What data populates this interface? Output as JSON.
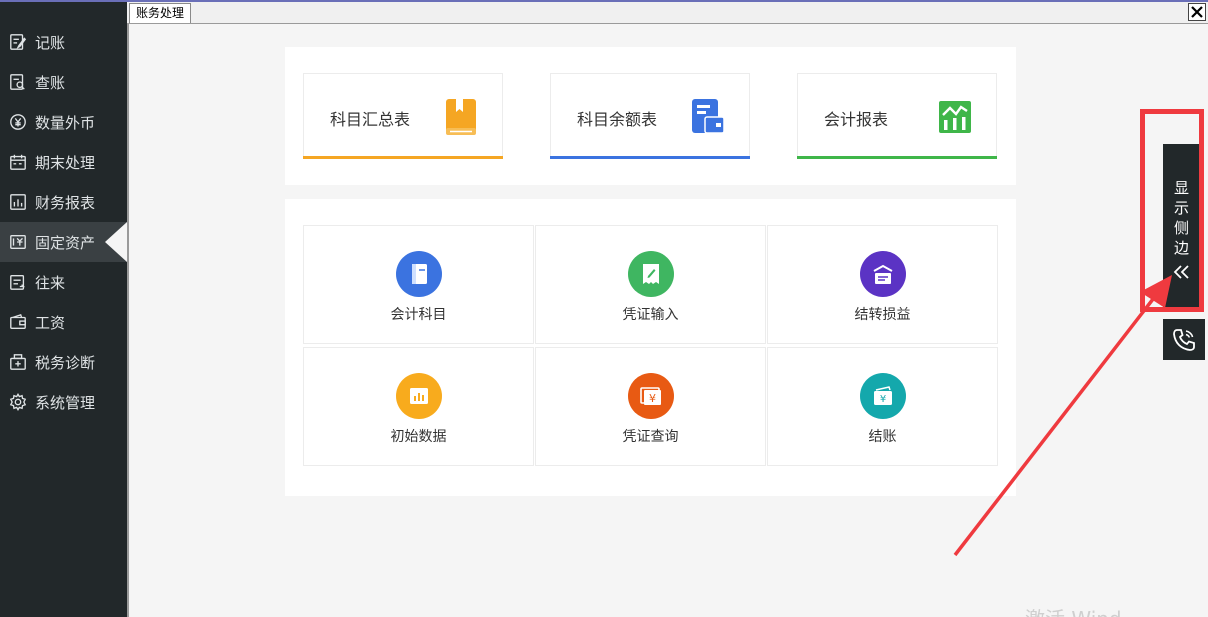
{
  "sidebar": {
    "items": [
      {
        "label": "记账",
        "icon": "edit-icon"
      },
      {
        "label": "查账",
        "icon": "search-doc-icon"
      },
      {
        "label": "数量外币",
        "icon": "yen-circle-icon"
      },
      {
        "label": "期末处理",
        "icon": "calendar-icon"
      },
      {
        "label": "财务报表",
        "icon": "chart-icon"
      },
      {
        "label": "固定资产",
        "icon": "asset-icon",
        "active": true
      },
      {
        "label": "往来",
        "icon": "exchange-icon"
      },
      {
        "label": "工资",
        "icon": "wallet-icon"
      },
      {
        "label": "税务诊断",
        "icon": "tax-icon"
      },
      {
        "label": "系统管理",
        "icon": "gear-icon"
      }
    ]
  },
  "tabbar": {
    "tab_label": "账务处理",
    "close_icon": "close-icon"
  },
  "reports": [
    {
      "label": "科目汇总表",
      "icon": "book-icon",
      "color": "#f5a623"
    },
    {
      "label": "科目余额表",
      "icon": "wallet-card-icon",
      "color": "#3b73e0"
    },
    {
      "label": "会计报表",
      "icon": "chart-bar-icon",
      "color": "#3fb649"
    }
  ],
  "functions": [
    {
      "label": "会计科目",
      "icon": "book-icon",
      "color": "#3b73e0"
    },
    {
      "label": "凭证输入",
      "icon": "voucher-edit-icon",
      "color": "#3fb661"
    },
    {
      "label": "结转损益",
      "icon": "transfer-icon",
      "color": "#5b33c4"
    },
    {
      "label": "初始数据",
      "icon": "data-chart-icon",
      "color": "#f8ab1d"
    },
    {
      "label": "凭证查询",
      "icon": "voucher-yen-icon",
      "color": "#e85a13"
    },
    {
      "label": "结账",
      "icon": "yen-wallet-icon",
      "color": "#14a8ac"
    }
  ],
  "side_panel": {
    "label_lines": [
      "显",
      "示",
      "侧",
      "边"
    ],
    "chevron_icon": "double-chevron-left-icon",
    "phone_icon": "phone-icon"
  },
  "watermark": "激活 Wind"
}
